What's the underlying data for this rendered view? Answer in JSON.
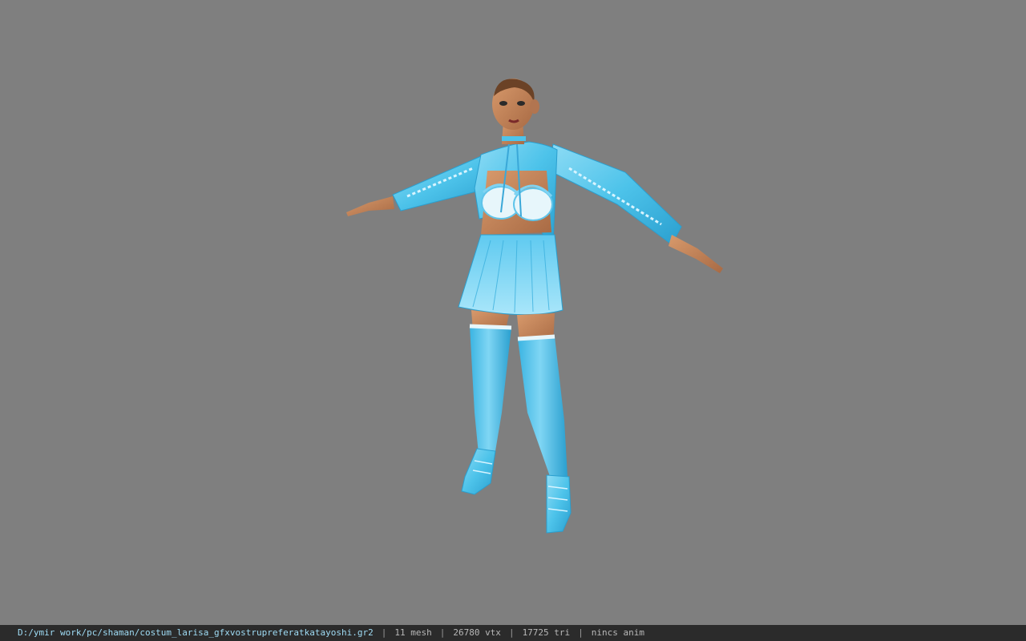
{
  "viewport": {
    "background": "#7f7f7f",
    "model_name": "costum_larisa_gfxvostrupreferatkatayoshi.gr2"
  },
  "status_bar": {
    "file_path": "D:/ymir work/pc/shaman/costum_larisa_gfxvostrupreferatkatayoshi.gr2",
    "separator": "|",
    "mesh_count": "11 mesh",
    "vertex_count": "26780 vtx",
    "triangle_count": "17725 tri",
    "anim_status": "nincs anim"
  },
  "colors": {
    "outfit": "#4dc3ea",
    "outfit_dark": "#2a9fcf",
    "outfit_light": "#9fe3f8",
    "skin": "#c98a5e",
    "skin_dark": "#9e6340",
    "hair": "#6b4226",
    "status_bg": "#2b2b2b",
    "status_text": "#8fd3f0"
  }
}
